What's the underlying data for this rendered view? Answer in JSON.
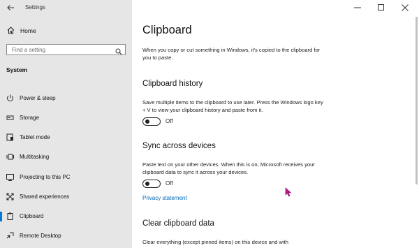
{
  "window": {
    "title": "Settings"
  },
  "sidebar": {
    "home_label": "Home",
    "search_placeholder": "Find a setting",
    "section_title": "System",
    "items": [
      {
        "label": "Power & sleep",
        "icon": "power-icon"
      },
      {
        "label": "Storage",
        "icon": "storage-icon"
      },
      {
        "label": "Tablet mode",
        "icon": "tablet-mode-icon"
      },
      {
        "label": "Multitasking",
        "icon": "multitasking-icon"
      },
      {
        "label": "Projecting to this PC",
        "icon": "projecting-icon"
      },
      {
        "label": "Shared experiences",
        "icon": "shared-experiences-icon"
      },
      {
        "label": "Clipboard",
        "icon": "clipboard-icon",
        "selected": true
      },
      {
        "label": "Remote Desktop",
        "icon": "remote-desktop-icon"
      }
    ]
  },
  "main": {
    "title": "Clipboard",
    "intro": "When you copy or cut something in Windows, it's copied to the clipboard for you to paste.",
    "history": {
      "heading": "Clipboard history",
      "description": "Save multiple items to the clipboard to use later. Press the Windows logo key + V to view your clipboard history and paste from it.",
      "toggle_state": "Off"
    },
    "sync": {
      "heading": "Sync across devices",
      "description": "Paste text on your other devices. When this is on, Microsoft receives your clipboard data to sync it across your devices.",
      "toggle_state": "Off",
      "link": "Privacy statement"
    },
    "clear": {
      "heading": "Clear clipboard data",
      "description": "Clear everything (except pinned items) on this device and with"
    }
  },
  "colors": {
    "accent": "#0078d7",
    "link": "#0067b8",
    "sidebar_bg": "#e6e6e6",
    "cursor": "#c2128a"
  }
}
